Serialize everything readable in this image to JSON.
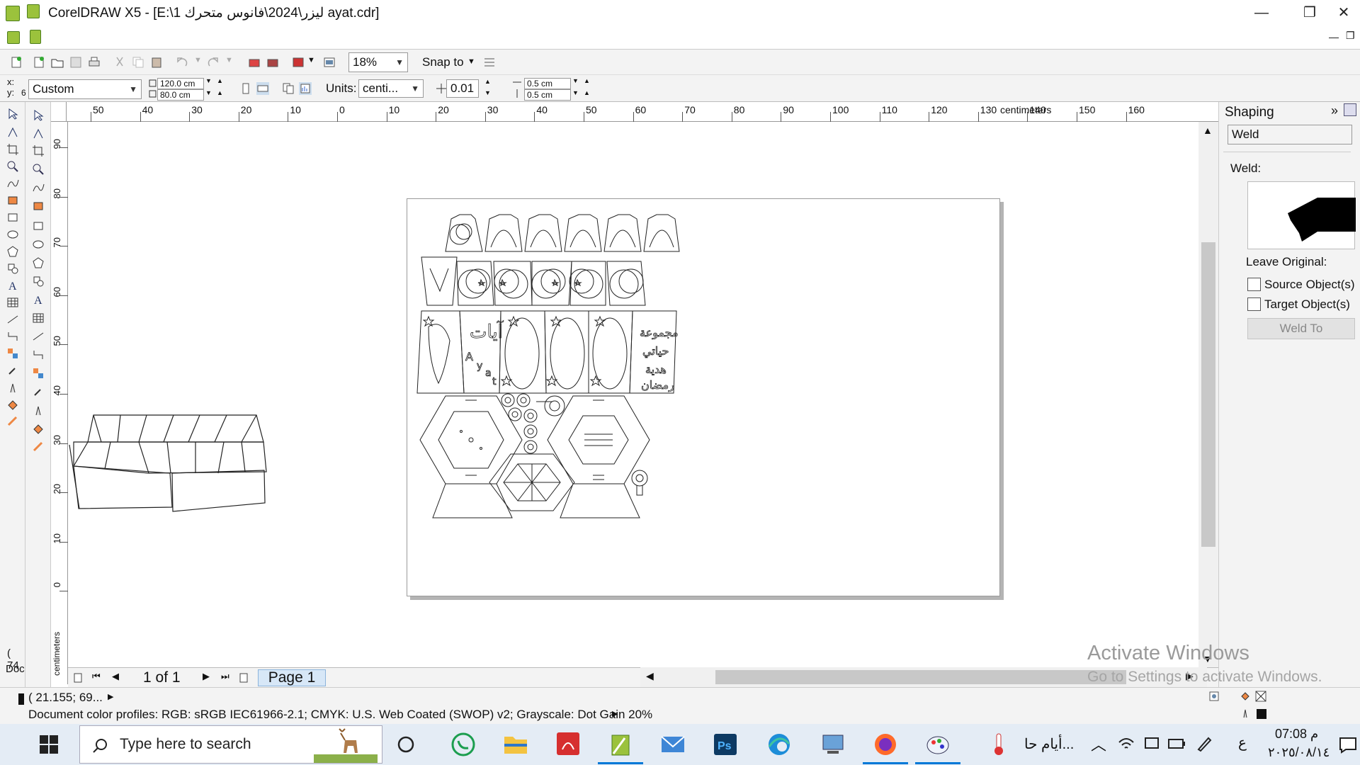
{
  "window": {
    "title": "CorelDRAW X5 - [E:\\1 ليزر\\2024\\فانوس متحرك ayat.cdr]",
    "minimize": "—",
    "restore": "❐",
    "close": "✕"
  },
  "toolbar": {
    "zoom": "18%",
    "snap_to": "Snap to"
  },
  "property_bar": {
    "xy_label": "x:\ny:",
    "x_value": "6",
    "preset": "Custom",
    "width": "120.0 cm",
    "height": "80.0 cm",
    "units_label": "Units:",
    "units_value": "centi...",
    "nudge": "0.01 c",
    "dup_x": "0.5 cm",
    "dup_y": "0.5 cm"
  },
  "ruler": {
    "h_ticks": [
      "50",
      "40",
      "30",
      "20",
      "10",
      "0",
      "10",
      "20",
      "30",
      "40",
      "50",
      "60",
      "70",
      "80",
      "90",
      "100",
      "110",
      "120",
      "130",
      "140",
      "150",
      "160"
    ],
    "h_unit": "centimeters",
    "v_ticks": [
      "90",
      "80",
      "70",
      "60",
      "50",
      "40",
      "30",
      "20",
      "10",
      "0"
    ],
    "v_unit": "centimeters"
  },
  "page_nav": {
    "counter": "1 of 1",
    "tab": "Page 1"
  },
  "docker": {
    "title": "Shaping",
    "mode": "Weld",
    "section_label": "Weld:",
    "leave_original": "Leave Original:",
    "source_objects": "Source Object(s)",
    "target_objects": "Target Object(s)",
    "weld_to": "Weld To"
  },
  "status": {
    "left_cut1": "( 74",
    "left_cut2": "Doc",
    "coords": "( 21.155; 69...",
    "profiles": "Document color profiles: RGB: sRGB IEC61966-2.1; CMYK: U.S. Web Coated (SWOP) v2; Grayscale: Dot Gain 20%"
  },
  "watermark": {
    "line1": "Activate Windows",
    "line2": "Go to Settings to activate Windows."
  },
  "taskbar": {
    "search_placeholder": "Type here to search",
    "weather": "أيام حا...",
    "time": "07:08 م",
    "date": "٢٠٢٥/٠٨/١٤",
    "lang": "ع"
  },
  "colors": {
    "accent": "#0078d7",
    "corel_green": "#9bc23c",
    "page_shadow": "#b4b4b4"
  }
}
